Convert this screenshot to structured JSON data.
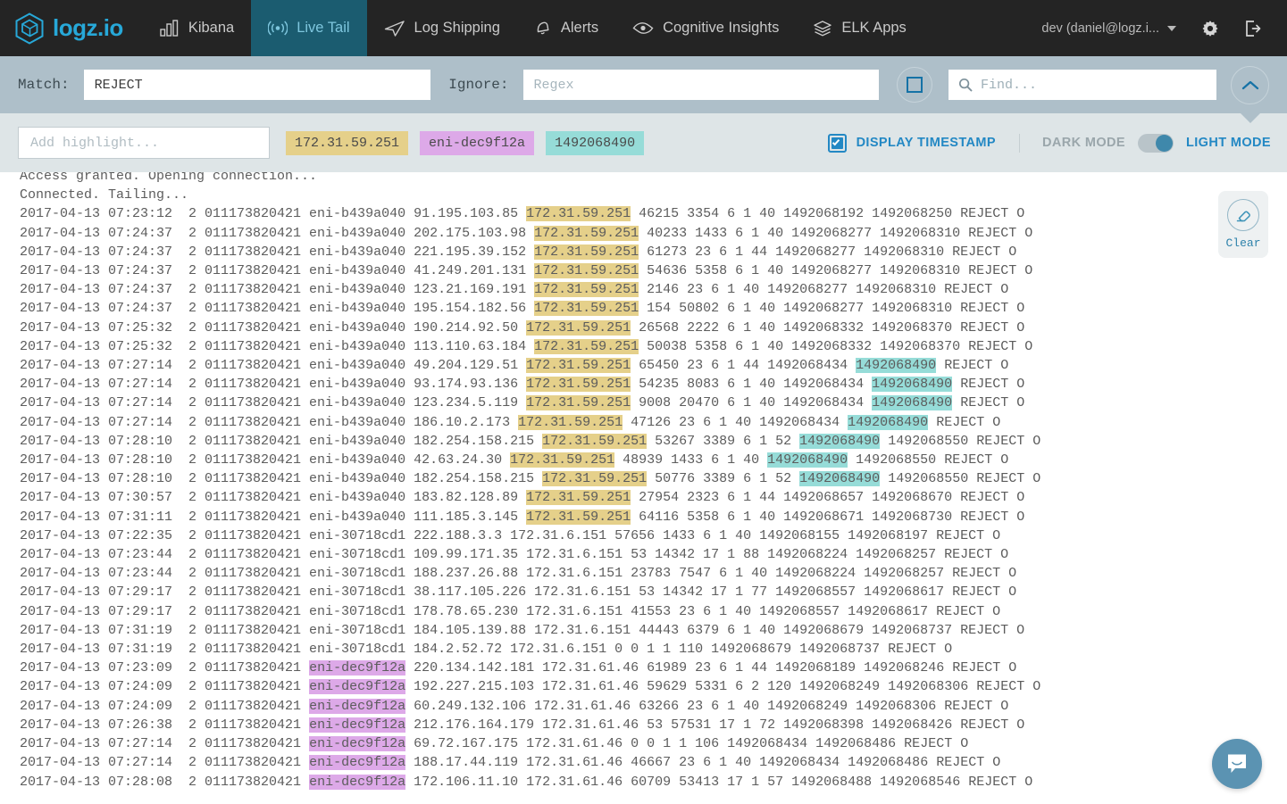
{
  "brand": {
    "name": "logz.io",
    "mark": "logz-cube-icon"
  },
  "nav": {
    "items": [
      {
        "label": "Kibana",
        "icon": "bar-chart-icon",
        "active": false
      },
      {
        "label": "Live Tail",
        "icon": "broadcast-icon",
        "active": true
      },
      {
        "label": "Log Shipping",
        "icon": "paper-plane-icon",
        "active": false
      },
      {
        "label": "Alerts",
        "icon": "bell-icon",
        "active": false
      },
      {
        "label": "Cognitive Insights",
        "icon": "eye-icon",
        "active": false
      },
      {
        "label": "ELK Apps",
        "icon": "layers-icon",
        "active": false
      }
    ],
    "user": "dev (daniel@logz.i...",
    "settings_icon": "gear-icon",
    "logout_icon": "logout-icon"
  },
  "matchbar": {
    "match_label": "Match:",
    "match_value": "REJECT",
    "match_placeholder": "Regex",
    "ignore_label": "Ignore:",
    "ignore_value": "",
    "ignore_placeholder": "Regex",
    "stop_button": "stop-icon",
    "find_value": "",
    "find_placeholder": "Find...",
    "collapse_button": "chevron-up-icon"
  },
  "highlightbar": {
    "add_value": "",
    "add_placeholder": "Add highlight...",
    "chips": [
      {
        "text": "172.31.59.251",
        "color": "#e5d08a"
      },
      {
        "text": "eni-dec9f12a",
        "color": "#dda9e8"
      },
      {
        "text": "1492068490",
        "color": "#96dcd8"
      }
    ],
    "display_timestamp_label": "DISPLAY TIMESTAMP",
    "display_timestamp_checked": true,
    "dark_mode_label": "DARK MODE",
    "light_mode_label": "LIGHT MODE",
    "mode_selected": "LIGHT MODE"
  },
  "clear": {
    "label": "Clear",
    "icon": "eraser-icon"
  },
  "chat": {
    "icon": "chat-bubble-icon"
  },
  "log": {
    "lines": [
      {
        "parts": [
          {
            "t": "Access granted. Opening connection..."
          }
        ]
      },
      {
        "parts": [
          {
            "t": "Connected. Tailing..."
          }
        ]
      },
      {
        "parts": [
          {
            "t": "2017-04-13 07:23:12  2 011173820421 eni-b439a040 91.195.103.85 "
          },
          {
            "t": "172.31.59.251",
            "h": "a"
          },
          {
            "t": " 46215 3354 6 1 40 1492068192 1492068250 REJECT O"
          }
        ]
      },
      {
        "parts": [
          {
            "t": "2017-04-13 07:24:37  2 011173820421 eni-b439a040 202.175.103.98 "
          },
          {
            "t": "172.31.59.251",
            "h": "a"
          },
          {
            "t": " 40233 1433 6 1 40 1492068277 1492068310 REJECT O"
          }
        ]
      },
      {
        "parts": [
          {
            "t": "2017-04-13 07:24:37  2 011173820421 eni-b439a040 221.195.39.152 "
          },
          {
            "t": "172.31.59.251",
            "h": "a"
          },
          {
            "t": " 61273 23 6 1 44 1492068277 1492068310 REJECT O"
          }
        ]
      },
      {
        "parts": [
          {
            "t": "2017-04-13 07:24:37  2 011173820421 eni-b439a040 41.249.201.131 "
          },
          {
            "t": "172.31.59.251",
            "h": "a"
          },
          {
            "t": " 54636 5358 6 1 40 1492068277 1492068310 REJECT O"
          }
        ]
      },
      {
        "parts": [
          {
            "t": "2017-04-13 07:24:37  2 011173820421 eni-b439a040 123.21.169.191 "
          },
          {
            "t": "172.31.59.251",
            "h": "a"
          },
          {
            "t": " 2146 23 6 1 40 1492068277 1492068310 REJECT O"
          }
        ]
      },
      {
        "parts": [
          {
            "t": "2017-04-13 07:24:37  2 011173820421 eni-b439a040 195.154.182.56 "
          },
          {
            "t": "172.31.59.251",
            "h": "a"
          },
          {
            "t": " 154 50802 6 1 40 1492068277 1492068310 REJECT O"
          }
        ]
      },
      {
        "parts": [
          {
            "t": "2017-04-13 07:25:32  2 011173820421 eni-b439a040 190.214.92.50 "
          },
          {
            "t": "172.31.59.251",
            "h": "a"
          },
          {
            "t": " 26568 2222 6 1 40 1492068332 1492068370 REJECT O"
          }
        ]
      },
      {
        "parts": [
          {
            "t": "2017-04-13 07:25:32  2 011173820421 eni-b439a040 113.110.63.184 "
          },
          {
            "t": "172.31.59.251",
            "h": "a"
          },
          {
            "t": " 50038 5358 6 1 40 1492068332 1492068370 REJECT O"
          }
        ]
      },
      {
        "parts": [
          {
            "t": "2017-04-13 07:27:14  2 011173820421 eni-b439a040 49.204.129.51 "
          },
          {
            "t": "172.31.59.251",
            "h": "a"
          },
          {
            "t": " 65450 23 6 1 44 1492068434 "
          },
          {
            "t": "1492068490",
            "h": "c"
          },
          {
            "t": " REJECT O"
          }
        ]
      },
      {
        "parts": [
          {
            "t": "2017-04-13 07:27:14  2 011173820421 eni-b439a040 93.174.93.136 "
          },
          {
            "t": "172.31.59.251",
            "h": "a"
          },
          {
            "t": " 54235 8083 6 1 40 1492068434 "
          },
          {
            "t": "1492068490",
            "h": "c"
          },
          {
            "t": " REJECT O"
          }
        ]
      },
      {
        "parts": [
          {
            "t": "2017-04-13 07:27:14  2 011173820421 eni-b439a040 123.234.5.119 "
          },
          {
            "t": "172.31.59.251",
            "h": "a"
          },
          {
            "t": " 9008 20470 6 1 40 1492068434 "
          },
          {
            "t": "1492068490",
            "h": "c"
          },
          {
            "t": " REJECT O"
          }
        ]
      },
      {
        "parts": [
          {
            "t": "2017-04-13 07:27:14  2 011173820421 eni-b439a040 186.10.2.173 "
          },
          {
            "t": "172.31.59.251",
            "h": "a"
          },
          {
            "t": " 47126 23 6 1 40 1492068434 "
          },
          {
            "t": "1492068490",
            "h": "c"
          },
          {
            "t": " REJECT O"
          }
        ]
      },
      {
        "parts": [
          {
            "t": "2017-04-13 07:28:10  2 011173820421 eni-b439a040 182.254.158.215 "
          },
          {
            "t": "172.31.59.251",
            "h": "a"
          },
          {
            "t": " 53267 3389 6 1 52 "
          },
          {
            "t": "1492068490",
            "h": "c"
          },
          {
            "t": " 1492068550 REJECT O"
          }
        ]
      },
      {
        "parts": [
          {
            "t": "2017-04-13 07:28:10  2 011173820421 eni-b439a040 42.63.24.30 "
          },
          {
            "t": "172.31.59.251",
            "h": "a"
          },
          {
            "t": " 48939 1433 6 1 40 "
          },
          {
            "t": "1492068490",
            "h": "c"
          },
          {
            "t": " 1492068550 REJECT O"
          }
        ]
      },
      {
        "parts": [
          {
            "t": "2017-04-13 07:28:10  2 011173820421 eni-b439a040 182.254.158.215 "
          },
          {
            "t": "172.31.59.251",
            "h": "a"
          },
          {
            "t": " 50776 3389 6 1 52 "
          },
          {
            "t": "1492068490",
            "h": "c"
          },
          {
            "t": " 1492068550 REJECT O"
          }
        ]
      },
      {
        "parts": [
          {
            "t": "2017-04-13 07:30:57  2 011173820421 eni-b439a040 183.82.128.89 "
          },
          {
            "t": "172.31.59.251",
            "h": "a"
          },
          {
            "t": " 27954 2323 6 1 44 1492068657 1492068670 REJECT O"
          }
        ]
      },
      {
        "parts": [
          {
            "t": "2017-04-13 07:31:11  2 011173820421 eni-b439a040 111.185.3.145 "
          },
          {
            "t": "172.31.59.251",
            "h": "a"
          },
          {
            "t": " 64116 5358 6 1 40 1492068671 1492068730 REJECT O"
          }
        ]
      },
      {
        "parts": [
          {
            "t": "2017-04-13 07:22:35  2 011173820421 eni-30718cd1 222.188.3.3 172.31.6.151 57656 1433 6 1 40 1492068155 1492068197 REJECT O"
          }
        ]
      },
      {
        "parts": [
          {
            "t": "2017-04-13 07:23:44  2 011173820421 eni-30718cd1 109.99.171.35 172.31.6.151 53 14342 17 1 88 1492068224 1492068257 REJECT O"
          }
        ]
      },
      {
        "parts": [
          {
            "t": "2017-04-13 07:23:44  2 011173820421 eni-30718cd1 188.237.26.88 172.31.6.151 23783 7547 6 1 40 1492068224 1492068257 REJECT O"
          }
        ]
      },
      {
        "parts": [
          {
            "t": "2017-04-13 07:29:17  2 011173820421 eni-30718cd1 38.117.105.226 172.31.6.151 53 14342 17 1 77 1492068557 1492068617 REJECT O"
          }
        ]
      },
      {
        "parts": [
          {
            "t": "2017-04-13 07:29:17  2 011173820421 eni-30718cd1 178.78.65.230 172.31.6.151 41553 23 6 1 40 1492068557 1492068617 REJECT O"
          }
        ]
      },
      {
        "parts": [
          {
            "t": "2017-04-13 07:31:19  2 011173820421 eni-30718cd1 184.105.139.88 172.31.6.151 44443 6379 6 1 40 1492068679 1492068737 REJECT O"
          }
        ]
      },
      {
        "parts": [
          {
            "t": "2017-04-13 07:31:19  2 011173820421 eni-30718cd1 184.2.52.72 172.31.6.151 0 0 1 1 110 1492068679 1492068737 REJECT O"
          }
        ]
      },
      {
        "parts": [
          {
            "t": "2017-04-13 07:23:09  2 011173820421 "
          },
          {
            "t": "eni-dec9f12a",
            "h": "b"
          },
          {
            "t": " 220.134.142.181 172.31.61.46 61989 23 6 1 44 1492068189 1492068246 REJECT O"
          }
        ]
      },
      {
        "parts": [
          {
            "t": "2017-04-13 07:24:09  2 011173820421 "
          },
          {
            "t": "eni-dec9f12a",
            "h": "b"
          },
          {
            "t": " 192.227.215.103 172.31.61.46 59629 5331 6 2 120 1492068249 1492068306 REJECT O"
          }
        ]
      },
      {
        "parts": [
          {
            "t": "2017-04-13 07:24:09  2 011173820421 "
          },
          {
            "t": "eni-dec9f12a",
            "h": "b"
          },
          {
            "t": " 60.249.132.106 172.31.61.46 63266 23 6 1 40 1492068249 1492068306 REJECT O"
          }
        ]
      },
      {
        "parts": [
          {
            "t": "2017-04-13 07:26:38  2 011173820421 "
          },
          {
            "t": "eni-dec9f12a",
            "h": "b"
          },
          {
            "t": " 212.176.164.179 172.31.61.46 53 57531 17 1 72 1492068398 1492068426 REJECT O"
          }
        ]
      },
      {
        "parts": [
          {
            "t": "2017-04-13 07:27:14  2 011173820421 "
          },
          {
            "t": "eni-dec9f12a",
            "h": "b"
          },
          {
            "t": " 69.72.167.175 172.31.61.46 0 0 1 1 106 1492068434 1492068486 REJECT O"
          }
        ]
      },
      {
        "parts": [
          {
            "t": "2017-04-13 07:27:14  2 011173820421 "
          },
          {
            "t": "eni-dec9f12a",
            "h": "b"
          },
          {
            "t": " 188.17.44.119 172.31.61.46 46667 23 6 1 40 1492068434 1492068486 REJECT O"
          }
        ]
      },
      {
        "parts": [
          {
            "t": "2017-04-13 07:28:08  2 011173820421 "
          },
          {
            "t": "eni-dec9f12a",
            "h": "b"
          },
          {
            "t": " 172.106.11.10 172.31.61.46 60709 53413 17 1 57 1492068488 1492068546 REJECT O"
          }
        ]
      }
    ]
  }
}
